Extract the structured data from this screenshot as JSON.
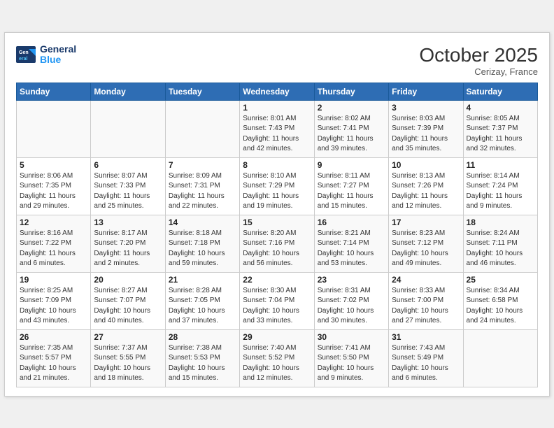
{
  "header": {
    "logo_line1": "General",
    "logo_line2": "Blue",
    "month": "October 2025",
    "location": "Cerizay, France"
  },
  "days_of_week": [
    "Sunday",
    "Monday",
    "Tuesday",
    "Wednesday",
    "Thursday",
    "Friday",
    "Saturday"
  ],
  "weeks": [
    [
      {
        "day": "",
        "info": ""
      },
      {
        "day": "",
        "info": ""
      },
      {
        "day": "",
        "info": ""
      },
      {
        "day": "1",
        "info": "Sunrise: 8:01 AM\nSunset: 7:43 PM\nDaylight: 11 hours\nand 42 minutes."
      },
      {
        "day": "2",
        "info": "Sunrise: 8:02 AM\nSunset: 7:41 PM\nDaylight: 11 hours\nand 39 minutes."
      },
      {
        "day": "3",
        "info": "Sunrise: 8:03 AM\nSunset: 7:39 PM\nDaylight: 11 hours\nand 35 minutes."
      },
      {
        "day": "4",
        "info": "Sunrise: 8:05 AM\nSunset: 7:37 PM\nDaylight: 11 hours\nand 32 minutes."
      }
    ],
    [
      {
        "day": "5",
        "info": "Sunrise: 8:06 AM\nSunset: 7:35 PM\nDaylight: 11 hours\nand 29 minutes."
      },
      {
        "day": "6",
        "info": "Sunrise: 8:07 AM\nSunset: 7:33 PM\nDaylight: 11 hours\nand 25 minutes."
      },
      {
        "day": "7",
        "info": "Sunrise: 8:09 AM\nSunset: 7:31 PM\nDaylight: 11 hours\nand 22 minutes."
      },
      {
        "day": "8",
        "info": "Sunrise: 8:10 AM\nSunset: 7:29 PM\nDaylight: 11 hours\nand 19 minutes."
      },
      {
        "day": "9",
        "info": "Sunrise: 8:11 AM\nSunset: 7:27 PM\nDaylight: 11 hours\nand 15 minutes."
      },
      {
        "day": "10",
        "info": "Sunrise: 8:13 AM\nSunset: 7:26 PM\nDaylight: 11 hours\nand 12 minutes."
      },
      {
        "day": "11",
        "info": "Sunrise: 8:14 AM\nSunset: 7:24 PM\nDaylight: 11 hours\nand 9 minutes."
      }
    ],
    [
      {
        "day": "12",
        "info": "Sunrise: 8:16 AM\nSunset: 7:22 PM\nDaylight: 11 hours\nand 6 minutes."
      },
      {
        "day": "13",
        "info": "Sunrise: 8:17 AM\nSunset: 7:20 PM\nDaylight: 11 hours\nand 2 minutes."
      },
      {
        "day": "14",
        "info": "Sunrise: 8:18 AM\nSunset: 7:18 PM\nDaylight: 10 hours\nand 59 minutes."
      },
      {
        "day": "15",
        "info": "Sunrise: 8:20 AM\nSunset: 7:16 PM\nDaylight: 10 hours\nand 56 minutes."
      },
      {
        "day": "16",
        "info": "Sunrise: 8:21 AM\nSunset: 7:14 PM\nDaylight: 10 hours\nand 53 minutes."
      },
      {
        "day": "17",
        "info": "Sunrise: 8:23 AM\nSunset: 7:12 PM\nDaylight: 10 hours\nand 49 minutes."
      },
      {
        "day": "18",
        "info": "Sunrise: 8:24 AM\nSunset: 7:11 PM\nDaylight: 10 hours\nand 46 minutes."
      }
    ],
    [
      {
        "day": "19",
        "info": "Sunrise: 8:25 AM\nSunset: 7:09 PM\nDaylight: 10 hours\nand 43 minutes."
      },
      {
        "day": "20",
        "info": "Sunrise: 8:27 AM\nSunset: 7:07 PM\nDaylight: 10 hours\nand 40 minutes."
      },
      {
        "day": "21",
        "info": "Sunrise: 8:28 AM\nSunset: 7:05 PM\nDaylight: 10 hours\nand 37 minutes."
      },
      {
        "day": "22",
        "info": "Sunrise: 8:30 AM\nSunset: 7:04 PM\nDaylight: 10 hours\nand 33 minutes."
      },
      {
        "day": "23",
        "info": "Sunrise: 8:31 AM\nSunset: 7:02 PM\nDaylight: 10 hours\nand 30 minutes."
      },
      {
        "day": "24",
        "info": "Sunrise: 8:33 AM\nSunset: 7:00 PM\nDaylight: 10 hours\nand 27 minutes."
      },
      {
        "day": "25",
        "info": "Sunrise: 8:34 AM\nSunset: 6:58 PM\nDaylight: 10 hours\nand 24 minutes."
      }
    ],
    [
      {
        "day": "26",
        "info": "Sunrise: 7:35 AM\nSunset: 5:57 PM\nDaylight: 10 hours\nand 21 minutes."
      },
      {
        "day": "27",
        "info": "Sunrise: 7:37 AM\nSunset: 5:55 PM\nDaylight: 10 hours\nand 18 minutes."
      },
      {
        "day": "28",
        "info": "Sunrise: 7:38 AM\nSunset: 5:53 PM\nDaylight: 10 hours\nand 15 minutes."
      },
      {
        "day": "29",
        "info": "Sunrise: 7:40 AM\nSunset: 5:52 PM\nDaylight: 10 hours\nand 12 minutes."
      },
      {
        "day": "30",
        "info": "Sunrise: 7:41 AM\nSunset: 5:50 PM\nDaylight: 10 hours\nand 9 minutes."
      },
      {
        "day": "31",
        "info": "Sunrise: 7:43 AM\nSunset: 5:49 PM\nDaylight: 10 hours\nand 6 minutes."
      },
      {
        "day": "",
        "info": ""
      }
    ]
  ]
}
